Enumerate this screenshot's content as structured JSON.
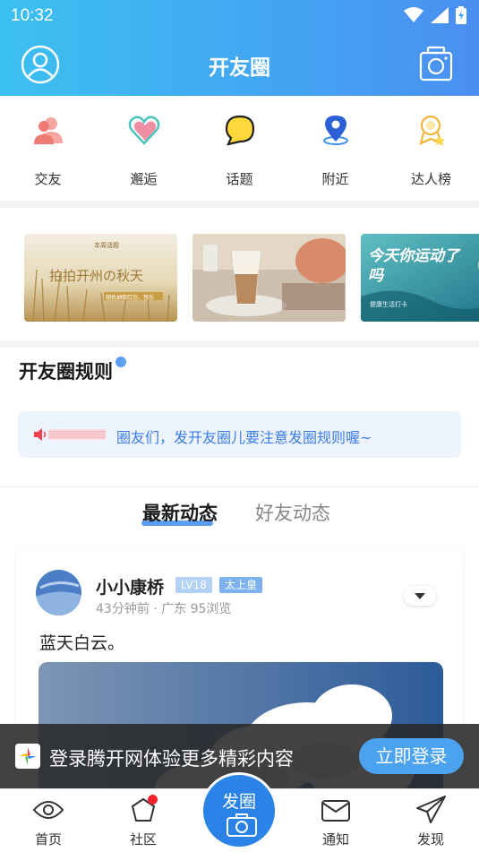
{
  "status_bar": {
    "time": "10:32"
  },
  "header": {
    "title": "开友圈"
  },
  "categories": [
    {
      "label": "交友",
      "icon": "friends-icon"
    },
    {
      "label": "邂逅",
      "icon": "heart-icon"
    },
    {
      "label": "话题",
      "icon": "chat-bubble-icon"
    },
    {
      "label": "附近",
      "icon": "location-pin-icon"
    },
    {
      "label": "达人榜",
      "icon": "award-icon"
    }
  ],
  "banners": [
    {
      "headline": "拍拍开州の秋天",
      "tagline": "随机抽取红包、音乐",
      "corner": "本周话题"
    },
    {
      "headline": ""
    },
    {
      "headline": "今天你运动了吗",
      "tagline": "健康生活打卡"
    }
  ],
  "rules": {
    "title": "开友圈规则",
    "notice": "圈友们，发开友圈儿要注意发圈规则喔~"
  },
  "tabs": {
    "active": "最新动态",
    "inactive": "好友动态"
  },
  "post": {
    "username": "小小康桥",
    "level_badge": "LV18",
    "title_badge": "太上皇",
    "meta": "43分钟前 · 广东  95浏览",
    "content": "蓝天白云。"
  },
  "login_bar": {
    "text": "登录腾开网体验更多精彩内容",
    "button": "立即登录"
  },
  "bottom_nav": {
    "home": "首页",
    "community": "社区",
    "post_fab": "发圈",
    "notifications": "通知",
    "discover": "发现"
  },
  "colors": {
    "accent": "#3f8df0",
    "header_start": "#3cc0f1",
    "header_end": "#4b8ff1",
    "notification_dot": "#f5222d"
  }
}
